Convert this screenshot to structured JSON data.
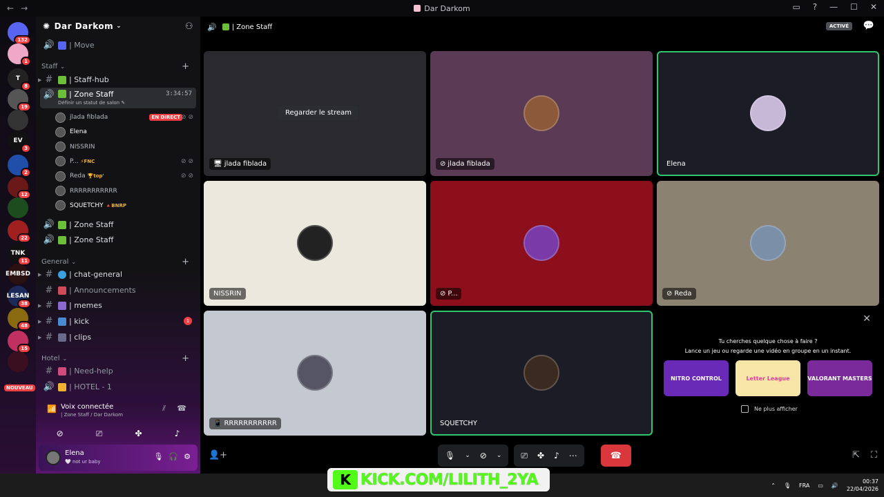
{
  "window": {
    "title": "Dar Darkom",
    "nav_back": "←",
    "nav_forward": "→",
    "controls": [
      "▭",
      "?",
      "—",
      "☐",
      "✕"
    ]
  },
  "rail": {
    "servers": [
      {
        "label": "",
        "badge": "132",
        "color": "#5865f2"
      },
      {
        "label": "",
        "badge": "1",
        "color": "#f0a8c8"
      },
      {
        "label": "T",
        "badge": "8",
        "color": "#222"
      },
      {
        "label": "",
        "badge": "19",
        "color": "#555"
      },
      {
        "label": "",
        "badge": "",
        "color": "#333"
      },
      {
        "label": "EV",
        "badge": "3",
        "color": "#111"
      },
      {
        "label": "",
        "badge": "2",
        "color": "#1f4fa8"
      },
      {
        "label": "",
        "badge": "12",
        "color": "#6a1818"
      },
      {
        "label": "",
        "badge": "",
        "color": "#1d4d1f"
      },
      {
        "label": "",
        "badge": "22",
        "color": "#a02020"
      },
      {
        "label": "TNK",
        "badge": "11",
        "color": "#111"
      },
      {
        "label": "EMBSD",
        "badge": "",
        "color": "#2a1010"
      },
      {
        "label": "LESAN",
        "badge": "38",
        "color": "#1c2a5a"
      },
      {
        "label": "",
        "badge": "48",
        "color": "#8a6a10"
      },
      {
        "label": "",
        "badge": "15",
        "color": "#c03060"
      },
      {
        "label": "",
        "badge": "",
        "color": "#3a1020"
      }
    ],
    "new_label": "NOUVEAU"
  },
  "sidebar": {
    "server_name": "Dar Darkom",
    "channels_top": [
      {
        "sym": "🔊",
        "label": "| Move"
      }
    ],
    "staff_category": "Staff",
    "staff": [
      {
        "sym": "#",
        "label": "| Staff-hub"
      },
      {
        "sym": "🔊",
        "label": "| Zone Staff",
        "timer": "3:34:57",
        "sub": "Définir un statut de salon ✎"
      }
    ],
    "voice_users": [
      {
        "name": "jlada fiblada",
        "tag": "",
        "live": "EN DIRECT",
        "icons": "⊘ ⊘"
      },
      {
        "name": "Elena",
        "tag": "",
        "live": "",
        "icons": ""
      },
      {
        "name": "NISSRIN",
        "tag": "",
        "live": "",
        "icons": ""
      },
      {
        "name": "P...",
        "tag": "⚡FNC",
        "live": "",
        "icons": "⊘ ⊘"
      },
      {
        "name": "Reda",
        "tag": "🏆top'",
        "live": "",
        "icons": "⊘ ⊘"
      },
      {
        "name": "RRRRRRRRRRR",
        "tag": "",
        "live": "",
        "icons": ""
      },
      {
        "name": "SQUETCHY",
        "tag": "🔺BNRP",
        "live": "",
        "icons": ""
      }
    ],
    "staff_more": [
      {
        "sym": "🔊",
        "label": "| Zone Staff"
      },
      {
        "sym": "🔊",
        "label": "| Zone Staff"
      }
    ],
    "general_category": "General",
    "general": [
      {
        "sym": "#",
        "label": "| chat-general",
        "badge": ""
      },
      {
        "sym": "#",
        "label": "| Announcements",
        "badge": ""
      },
      {
        "sym": "#",
        "label": "| memes",
        "badge": ""
      },
      {
        "sym": "#",
        "label": "| kick",
        "badge": "1"
      },
      {
        "sym": "#",
        "label": "| clips",
        "badge": ""
      }
    ],
    "hotel_category": "Hotel",
    "hotel": [
      {
        "sym": "#",
        "label": "| Need-help"
      },
      {
        "sym": "🔊",
        "label": "| HOTEL - 1"
      }
    ],
    "voice_connected": {
      "title": "Voix connectée",
      "subtitle": "| Zone Staff / Dar Darkom"
    },
    "user": {
      "name": "Elena",
      "status": "🤍 not ur baby"
    }
  },
  "main": {
    "channel_title": "| Zone Staff",
    "active_badge": "ACTIVÉ",
    "tiles": [
      {
        "name": "jlada fiblada",
        "bg": "#2a2a2e",
        "avatar": "",
        "watch": "Regarder le stream",
        "label_prefix": "🖥"
      },
      {
        "name": "jlada fiblada",
        "bg": "#5a3a55",
        "avatar": "#8a5a3a",
        "watch": "",
        "label_prefix": "⊘"
      },
      {
        "name": "Elena",
        "bg": "#1c1c26",
        "avatar": "#c8b8d8",
        "watch": "",
        "label_prefix": ""
      },
      {
        "name": "NISSRIN",
        "bg": "#ebe8de",
        "avatar": "#222",
        "watch": "",
        "label_prefix": ""
      },
      {
        "name": "P...",
        "bg": "#8e0f1c",
        "avatar": "#7a3aa8",
        "watch": "",
        "label_prefix": "⊘"
      },
      {
        "name": "Reda",
        "bg": "#8c8272",
        "avatar": "#7a8fa8",
        "watch": "",
        "label_prefix": "⊘"
      },
      {
        "name": "RRRRRRRRRRR",
        "bg": "#c4c8d0",
        "avatar": "#556",
        "watch": "",
        "label_prefix": "📱"
      },
      {
        "name": "SQUETCHY",
        "bg": "#1c1c26",
        "avatar": "#3a2a20",
        "watch": "",
        "label_prefix": ""
      }
    ],
    "activity": {
      "question": "Tu cherches quelque chose à faire ?",
      "description": "Lance un jeu ou regarde une vidéo en groupe en un instant.",
      "games": [
        {
          "name": "NITRO CONTROL",
          "color": "#6a2ab8"
        },
        {
          "name": "Letter League",
          "color": "#f7e6a8"
        },
        {
          "name": "VALORANT MASTERS",
          "color": "#7a2a9a"
        }
      ],
      "dont_show": "Ne plus afficher"
    }
  },
  "overlay": {
    "kick_text": "KICK.COM/LILITH_2YA"
  },
  "taskbar": {
    "lang": "FRA",
    "time": "00:37",
    "date": "22/04/2026"
  }
}
